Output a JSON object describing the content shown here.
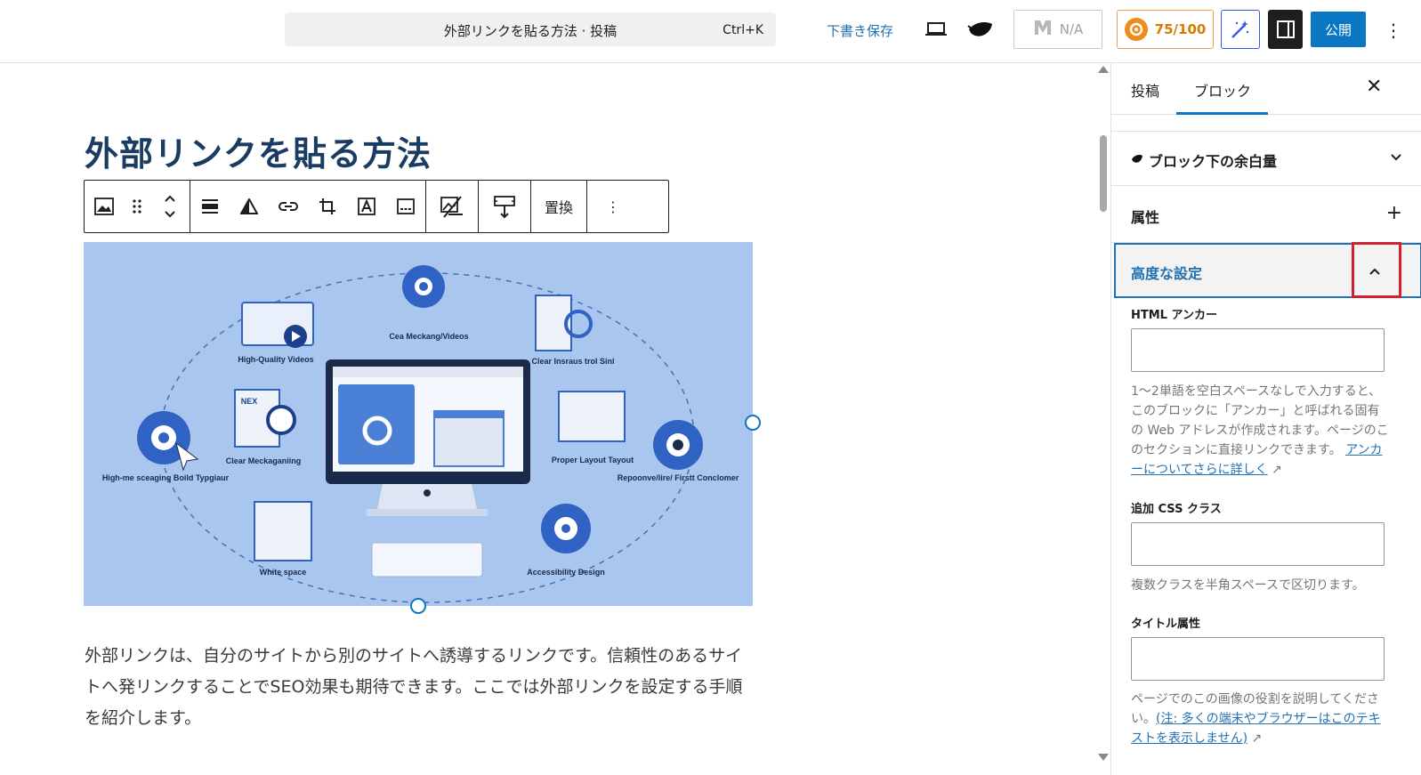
{
  "header": {
    "command_title": "外部リンクを貼る方法 · 投稿",
    "command_shortcut": "Ctrl+K",
    "save_draft": "下書き保存",
    "na_label": "N/A",
    "score": "75/100",
    "publish": "公開"
  },
  "post": {
    "title": "外部リンクを貼る方法",
    "toolbar_replace": "置換",
    "paragraph": "外部リンクは、自分のサイトから別のサイトへ誘導するリンクです。信頼性のあるサイトへ発リンクすることでSEO効果も期待できます。ここでは外部リンクを設定する手順を紹介します。"
  },
  "image_labels": {
    "videos": "High-Quality Videos",
    "top": "Cea Meckang/Videos",
    "top_right": "Clear Insraus trol Sinl",
    "left_mid": "Clear Meckaganiing",
    "right_mid": "Proper Layout Tayout",
    "far_left": "High-me sceaging Boild Typgiaur",
    "far_right": "Repoonve/lire/ Firstt Conclomer",
    "bottom_left": "White space",
    "bottom_right": "Accessibility Design",
    "nex": "NEX"
  },
  "sidebar": {
    "tab_post": "投稿",
    "tab_block": "ブロック",
    "panel_spacing": "ブロック下の余白量",
    "panel_attributes": "属性",
    "panel_advanced": "高度な設定",
    "html_anchor_label": "HTML アンカー",
    "html_anchor_value": "",
    "html_anchor_help": "1〜2単語を空白スペースなしで入力すると、このブロックに「アンカー」と呼ばれる固有の Web アドレスが作成されます。ページのこのセクションに直接リンクできます。",
    "html_anchor_link": "アンカーについてさらに詳しく",
    "css_class_label": "追加 CSS クラス",
    "css_class_value": "",
    "css_class_help": "複数クラスを半角スペースで区切ります。",
    "title_attr_label": "タイトル属性",
    "title_attr_value": "",
    "title_attr_help": "ページでのこの画像の役割を説明してください。",
    "title_attr_link": "(注: 多くの端末やブラウザーはこのテキストを表示しません)"
  },
  "colors": {
    "accent": "#0a76c4",
    "title": "#1b3c62",
    "highlight": "#d42030"
  }
}
